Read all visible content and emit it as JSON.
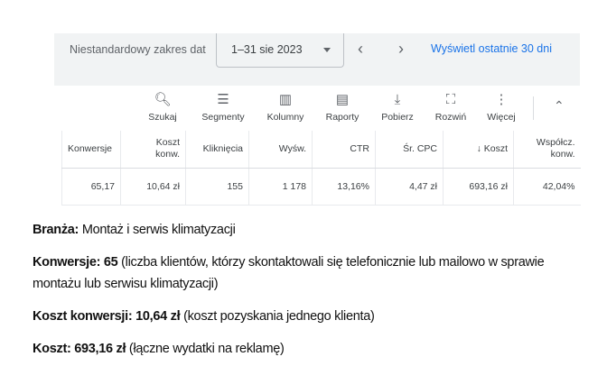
{
  "date_bar": {
    "label": "Niestandardowy zakres dat",
    "range": "1–31 sie 2023",
    "prev": "‹",
    "next": "›",
    "last30": "Wyświetl ostatnie 30 dni"
  },
  "toolbar": [
    {
      "label": "Szukaj",
      "icon": "search-icon",
      "glyph": "🔍︎"
    },
    {
      "label": "Segmenty",
      "icon": "segments-icon",
      "glyph": "☰"
    },
    {
      "label": "Kolumny",
      "icon": "columns-icon",
      "glyph": "▥"
    },
    {
      "label": "Raporty",
      "icon": "reports-icon",
      "glyph": "▤"
    },
    {
      "label": "Pobierz",
      "icon": "download-icon",
      "glyph": "⤓"
    },
    {
      "label": "Rozwiń",
      "icon": "expand-icon",
      "glyph": "⛶"
    },
    {
      "label": "Więcej",
      "icon": "more-icon",
      "glyph": "⋮"
    }
  ],
  "collapse_glyph": "⌃",
  "table": {
    "headers": [
      "Konwersje",
      "Koszt konw.",
      "Kliknięcia",
      "Wyśw.",
      "CTR",
      "Śr. CPC",
      "↓ Koszt",
      "Współcz. konw."
    ],
    "row": [
      "65,17",
      "10,64 zł",
      "155",
      "1 178",
      "13,16%",
      "4,47 zł",
      "693,16 zł",
      "42,04%"
    ]
  },
  "notes": [
    {
      "bold": "Branża:",
      "text": " Montaż i serwis klimatyzacji"
    },
    {
      "bold": "Konwersje: 65",
      "text": " (liczba klientów, którzy skontaktowali się telefonicznie lub mailowo w sprawie montażu lub serwisu klimatyzacji)"
    },
    {
      "bold": "Koszt konwersji: 10,64 zł",
      "text": " (koszt pozyskania jednego klienta)"
    },
    {
      "bold": "Koszt: 693,16 zł",
      "text": " (łączne wydatki na reklamę)"
    }
  ]
}
